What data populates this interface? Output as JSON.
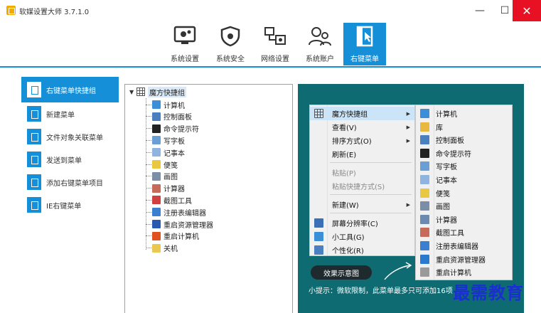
{
  "window": {
    "title": "软媒设置大师 3.7.1.0",
    "minimize": "—",
    "maximize": "☐",
    "close": "✕"
  },
  "toolbar": {
    "items": [
      {
        "label": "系统设置",
        "icon": "gear-monitor-icon"
      },
      {
        "label": "系统安全",
        "icon": "shield-icon"
      },
      {
        "label": "网络设置",
        "icon": "network-icon"
      },
      {
        "label": "系统账户",
        "icon": "users-icon"
      },
      {
        "label": "右键菜单",
        "icon": "cursor-panel-icon",
        "active": true
      }
    ],
    "accent": "#1590d8"
  },
  "leftnav": {
    "items": [
      {
        "label": "右键菜单快捷组",
        "active": true
      },
      {
        "label": "新建菜单"
      },
      {
        "label": "文件对象关联菜单"
      },
      {
        "label": "发送到菜单"
      },
      {
        "label": "添加右键菜单项目"
      },
      {
        "label": "IE右键菜单"
      }
    ]
  },
  "tree": {
    "root": "魔方快捷组",
    "items": [
      {
        "label": "计算机",
        "color": "#3a8fd8"
      },
      {
        "label": "控制面板",
        "color": "#4a7fc0"
      },
      {
        "label": "命令提示符",
        "color": "#222222"
      },
      {
        "label": "写字板",
        "color": "#6a9fd6"
      },
      {
        "label": "记事本",
        "color": "#8fb4e0"
      },
      {
        "label": "便笺",
        "color": "#e8c840"
      },
      {
        "label": "画图",
        "color": "#7a8ea8"
      },
      {
        "label": "计算器",
        "color": "#c86a5a"
      },
      {
        "label": "截图工具",
        "color": "#d04040"
      },
      {
        "label": "注册表编辑器",
        "color": "#3a7fd0"
      },
      {
        "label": "重启资源管理器",
        "color": "#2a5ab0"
      },
      {
        "label": "重启计算机",
        "color": "#e05020"
      },
      {
        "label": "关机",
        "color": "#e8c850"
      }
    ]
  },
  "preview": {
    "menu1": [
      {
        "label": "魔方快捷组",
        "submenu": true,
        "highlight": true
      },
      {
        "label": "查看(V)",
        "submenu": true
      },
      {
        "label": "排序方式(O)",
        "submenu": true
      },
      {
        "label": "刷新(E)"
      },
      {
        "label": "粘贴(P)",
        "disabled": true
      },
      {
        "label": "粘贴快捷方式(S)",
        "disabled": true
      },
      {
        "label": "新建(W)",
        "submenu": true
      },
      {
        "label": "屏幕分辨率(C)"
      },
      {
        "label": "小工具(G)"
      },
      {
        "label": "个性化(R)"
      }
    ],
    "menu2": [
      {
        "label": "计算机"
      },
      {
        "label": "库"
      },
      {
        "label": "控制面板"
      },
      {
        "label": "命令提示符"
      },
      {
        "label": "写字板"
      },
      {
        "label": "记事本"
      },
      {
        "label": "便笺"
      },
      {
        "label": "画图"
      },
      {
        "label": "计算器"
      },
      {
        "label": "截图工具"
      },
      {
        "label": "注册表编辑器"
      },
      {
        "label": "重启资源管理器"
      },
      {
        "label": "重启计算机"
      }
    ],
    "demo_button": "效果示意图",
    "tip": "小提示：微软限制，此菜单最多只可添加16项"
  },
  "watermark": "最需教育"
}
